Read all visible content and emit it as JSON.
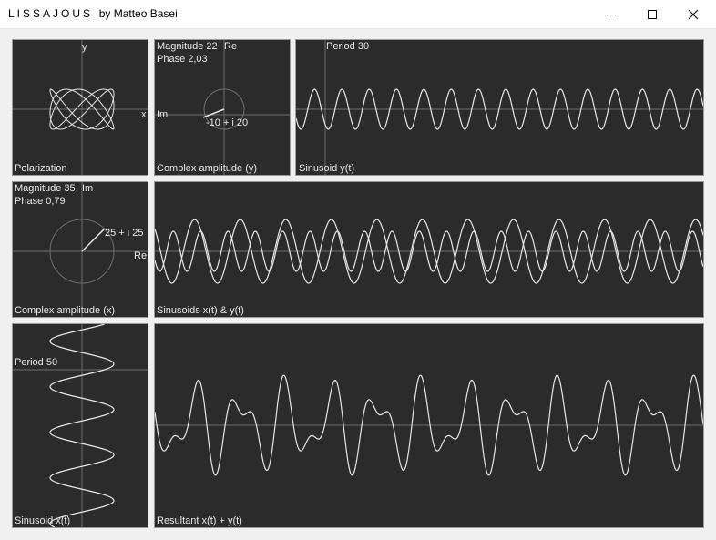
{
  "window": {
    "app_name": "LISSAJOUS",
    "byline": "by Matteo Basei",
    "controls": [
      "minimize",
      "maximize",
      "close"
    ]
  },
  "polarization": {
    "label": "Polarization",
    "axis_x": "x",
    "axis_y": "y"
  },
  "complex_y": {
    "magnitude_text": "Magnitude 22",
    "phase_text": "Phase 2,03",
    "re_axis": "Re",
    "im_axis": "Im",
    "value_text": "-10 + i 20",
    "label": "Complex amplitude (y)",
    "re": -10,
    "im": 20,
    "magnitude": 22,
    "phase": 2.03
  },
  "sinusoid_y": {
    "period_text": "Period 30",
    "label": "Sinusoid y(t)",
    "period": 30
  },
  "complex_x": {
    "magnitude_text": "Magnitude 35",
    "phase_text": "Phase 0,79",
    "im_axis": "Im",
    "re_axis": "Re",
    "value_text": "25 + i 25",
    "label": "Complex amplitude (x)",
    "re": 25,
    "im": 25,
    "magnitude": 35,
    "phase": 0.79
  },
  "sinusoids_xy": {
    "label": "Sinusoids x(t) & y(t)"
  },
  "sinusoid_x": {
    "period_text": "Period 50",
    "label": "Sinusoid x(t)",
    "period": 50
  },
  "resultant": {
    "label": "Resultant x(t) + y(t)"
  },
  "colors": {
    "panel_bg": "#2b2b2b",
    "curve": "#e6e6e6",
    "axis": "#6e6e6e",
    "text": "#e8e8e8"
  }
}
